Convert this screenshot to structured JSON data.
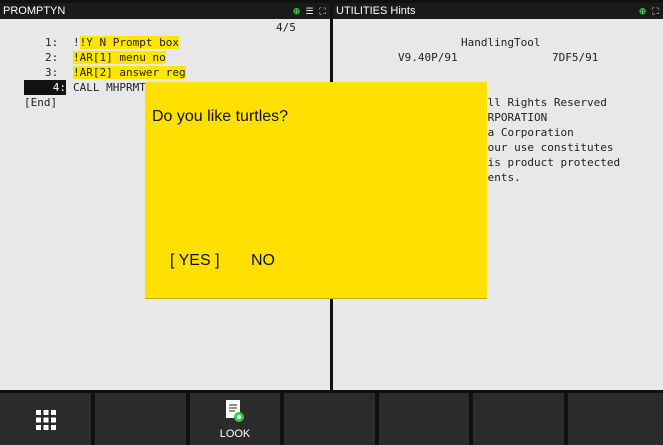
{
  "left_pane": {
    "title": "PROMPTYN",
    "position": "4/5",
    "lines": [
      {
        "num": "1:",
        "text": "!Y N Prompt box"
      },
      {
        "num": "2:",
        "text": "!AR[1] menu no"
      },
      {
        "num": "3:",
        "text": "!AR[2] answer reg"
      },
      {
        "num": "4:",
        "text": "CALL MHPRMT"
      }
    ],
    "end_label": "[End]"
  },
  "right_pane": {
    "title": "UTILITIES Hints",
    "lines": [
      "HandlingTool",
      "V9.40P/91",
      "7DF5/91",
      "All Rights Reserved",
      "ORPORATION",
      "ca Corporation",
      "Your use constitutes",
      "his product protected",
      "tents."
    ]
  },
  "dialog": {
    "question": "Do you like turtles?",
    "yes_label": "[ YES ]",
    "no_label": "NO"
  },
  "softkeys": {
    "look_label": "LOOK"
  },
  "icons": {
    "pane_zoom": "zoom-in-icon",
    "pane_menu": "menu-icon",
    "pane_maximize": "maximize-icon",
    "grid": "grid-menu-icon",
    "look": "look-icon"
  }
}
